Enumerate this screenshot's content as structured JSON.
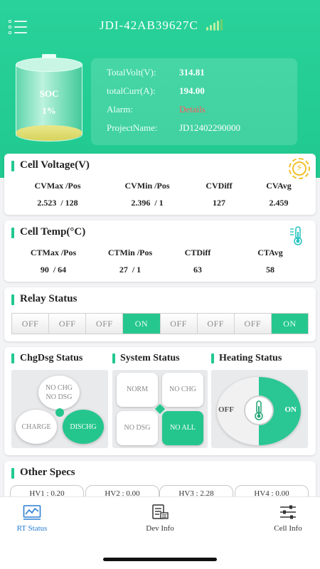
{
  "header": {
    "device_name": "JDI-42AB39627C"
  },
  "battery": {
    "soc_label": "SOC",
    "soc_value": "1%",
    "soc_fraction": 0.01
  },
  "summary": {
    "rows": [
      {
        "label": "TotalVolt(V):",
        "value": "314.81"
      },
      {
        "label": "totalCurr(A):",
        "value": "194.00"
      },
      {
        "label": "Alarm:",
        "value": "Details"
      },
      {
        "label": "ProjectName:",
        "value": "JD12402290000"
      }
    ],
    "alarm_color": "#ff5a5a"
  },
  "cell_voltage": {
    "title": "Cell Voltage(V)",
    "icon": "lightning-icon",
    "headers": [
      "CVMax /Pos",
      "CVMin /Pos",
      "CVDiff",
      "CVAvg"
    ],
    "values": [
      "2.523  / 128",
      "2.396  / 1",
      "127",
      "2.459"
    ]
  },
  "cell_temp": {
    "title": "Cell Temp(°C)",
    "icon": "thermometer-icon",
    "headers": [
      "CTMax /Pos",
      "CTMin /Pos",
      "CTDiff",
      "CTAvg"
    ],
    "values": [
      "90  / 64",
      "27  / 1",
      "63",
      "58"
    ]
  },
  "relay": {
    "title": "Relay Status",
    "items": [
      {
        "label": "OFF",
        "on": false
      },
      {
        "label": "OFF",
        "on": false
      },
      {
        "label": "OFF",
        "on": false
      },
      {
        "label": "ON",
        "on": true
      },
      {
        "label": "OFF",
        "on": false
      },
      {
        "label": "OFF",
        "on": false
      },
      {
        "label": "OFF",
        "on": false
      },
      {
        "label": "ON",
        "on": true
      }
    ]
  },
  "chgdsg": {
    "title": "ChgDsg Status",
    "no_chg_no_dsg": "NO CHG\nNO DSG",
    "charge": "CHARGE",
    "discharge": "DISCHG"
  },
  "system": {
    "title": "System Status",
    "norm": "NORM",
    "no_chg": "NO CHG",
    "no_dsg": "NO DSG",
    "no_all": "NO ALL"
  },
  "heating": {
    "title": "Heating Status",
    "off_label": "OFF",
    "on_label": "ON"
  },
  "other_specs": {
    "title": "Other Specs",
    "items": [
      "HV1 : 0.20",
      "HV2 : 0.00",
      "HV3 : 2.28",
      "HV4 : 0.00"
    ]
  },
  "tabs": [
    {
      "label": "RT Status",
      "icon": "chart-icon",
      "active": true
    },
    {
      "label": "Dev Info",
      "icon": "document-icon",
      "active": false
    },
    {
      "label": "Cell Info",
      "icon": "sliders-icon",
      "active": false
    }
  ],
  "colors": {
    "accent": "#22c891",
    "header_bg": "#29d29a",
    "active_tab": "#2a7fd4",
    "bolt": "#f3c12a"
  }
}
